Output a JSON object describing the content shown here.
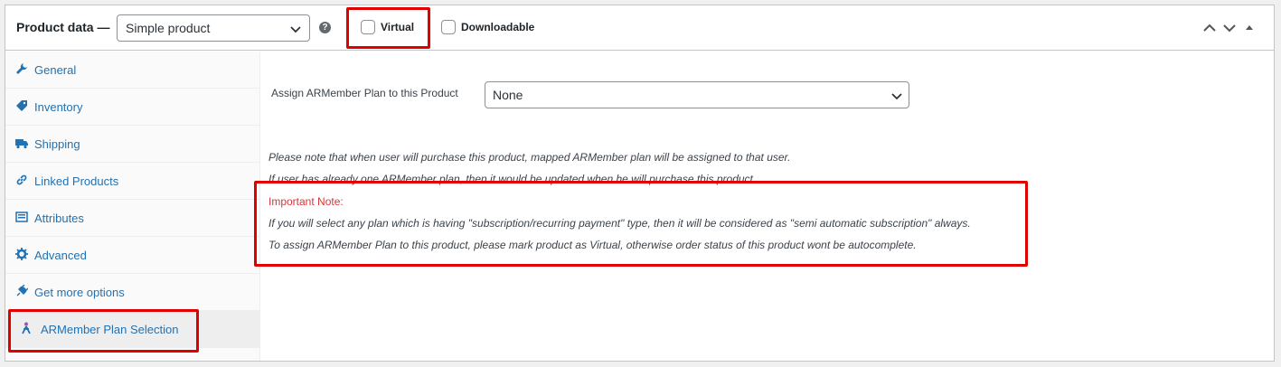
{
  "header": {
    "title": "Product data —",
    "product_type": "Simple product",
    "help_icon": "question-circle-icon",
    "virtual_label": "Virtual",
    "virtual_checked": false,
    "downloadable_label": "Downloadable",
    "downloadable_checked": false,
    "controls": [
      "chevron-up-icon",
      "chevron-down-icon",
      "triangle-up-icon"
    ]
  },
  "tabs": [
    {
      "label": "General",
      "icon": "wrench-icon"
    },
    {
      "label": "Inventory",
      "icon": "tag-icon"
    },
    {
      "label": "Shipping",
      "icon": "truck-icon"
    },
    {
      "label": "Linked Products",
      "icon": "link-icon"
    },
    {
      "label": "Attributes",
      "icon": "list-icon"
    },
    {
      "label": "Advanced",
      "icon": "gear-icon"
    },
    {
      "label": "Get more options",
      "icon": "plugin-icon"
    },
    {
      "label": "ARMember Plan Selection",
      "icon": "armember-icon",
      "active": true
    }
  ],
  "content": {
    "field_label": "Assign ARMember Plan to this Product",
    "plan_value": "None",
    "notes": [
      "Please note that when user will purchase this product, mapped ARMember plan will be assigned to that user.",
      "If user has already one ARMember plan, then it would be updated when he will purchase this product."
    ],
    "important_title": "Important Note:",
    "important_notes": [
      "If you will select any plan which is having \"subscription/recurring payment\" type, then it will be considered as \"semi automatic subscription\" always.",
      "To assign ARMember Plan to this product, please mark product as Virtual, otherwise order status of this product wont be autocomplete."
    ]
  },
  "colors": {
    "link": "#2271b1",
    "highlight": "#e00000",
    "important": "#d63638"
  }
}
